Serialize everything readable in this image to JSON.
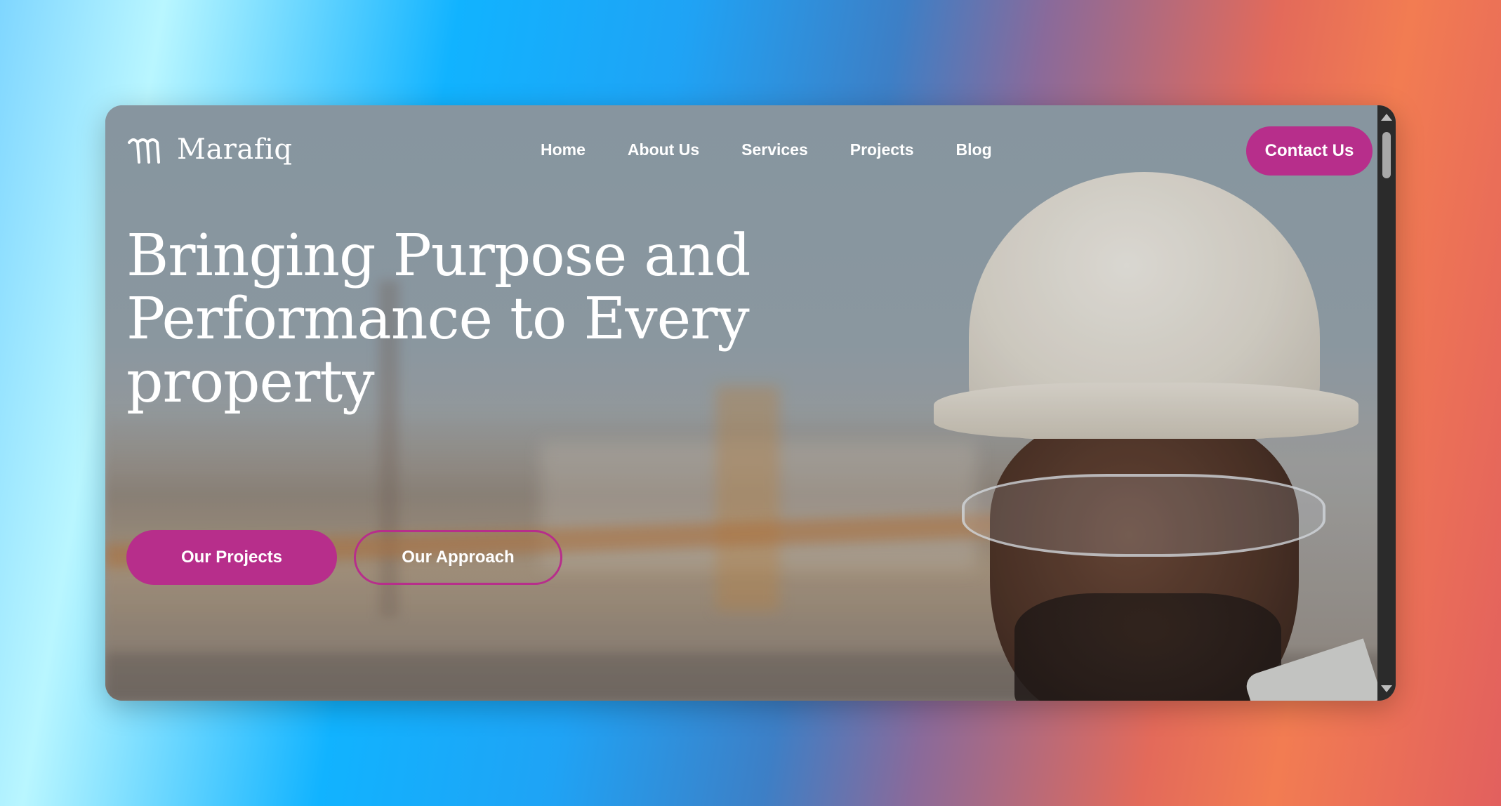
{
  "brand": {
    "name": "Marafiq",
    "logo_icon": "marafiq-logo-icon"
  },
  "nav": {
    "items": [
      {
        "label": "Home"
      },
      {
        "label": "About Us"
      },
      {
        "label": "Services"
      },
      {
        "label": "Projects"
      },
      {
        "label": "Blog"
      }
    ],
    "contact_label": "Contact Us"
  },
  "hero": {
    "headline_line1": "Bringing Purpose and",
    "headline_line2": "Performance to Every",
    "headline_line3": "property",
    "primary_cta": "Our Projects",
    "secondary_cta": "Our Approach",
    "image_subject": "construction-worker-hardhat-photo"
  },
  "colors": {
    "accent": "#b72e8b",
    "text": "#ffffff"
  }
}
